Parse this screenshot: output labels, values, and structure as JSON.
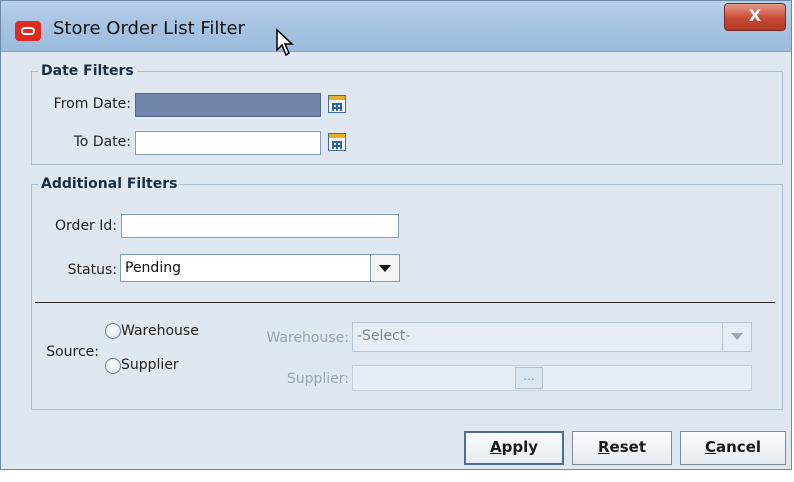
{
  "window": {
    "title": "Store Order List Filter",
    "close_label": "X"
  },
  "date_filters": {
    "legend": "Date Filters",
    "from_label": "From Date:",
    "from_value": "",
    "to_label": "To Date:",
    "to_value": "",
    "calendar_icon": "calendar-icon"
  },
  "additional_filters": {
    "legend": "Additional Filters",
    "order_id_label": "Order Id:",
    "order_id_value": "",
    "status_label": "Status:",
    "status_value": "Pending",
    "source_label": "Source:",
    "source_options": [
      "Warehouse",
      "Supplier"
    ],
    "warehouse_label": "Warehouse:",
    "warehouse_value": "-Select-",
    "supplier_label": "Supplier:",
    "supplier_browse": "..."
  },
  "buttons": {
    "apply_first": "A",
    "apply_rest": "pply",
    "reset_first": "R",
    "reset_rest": "eset",
    "cancel_first": "C",
    "cancel_rest": "ancel"
  },
  "colors": {
    "titlebar": "#a8c4e2",
    "panel": "#dce6f0",
    "close_button": "#c64a34",
    "selected_field": "#6f86a8"
  }
}
